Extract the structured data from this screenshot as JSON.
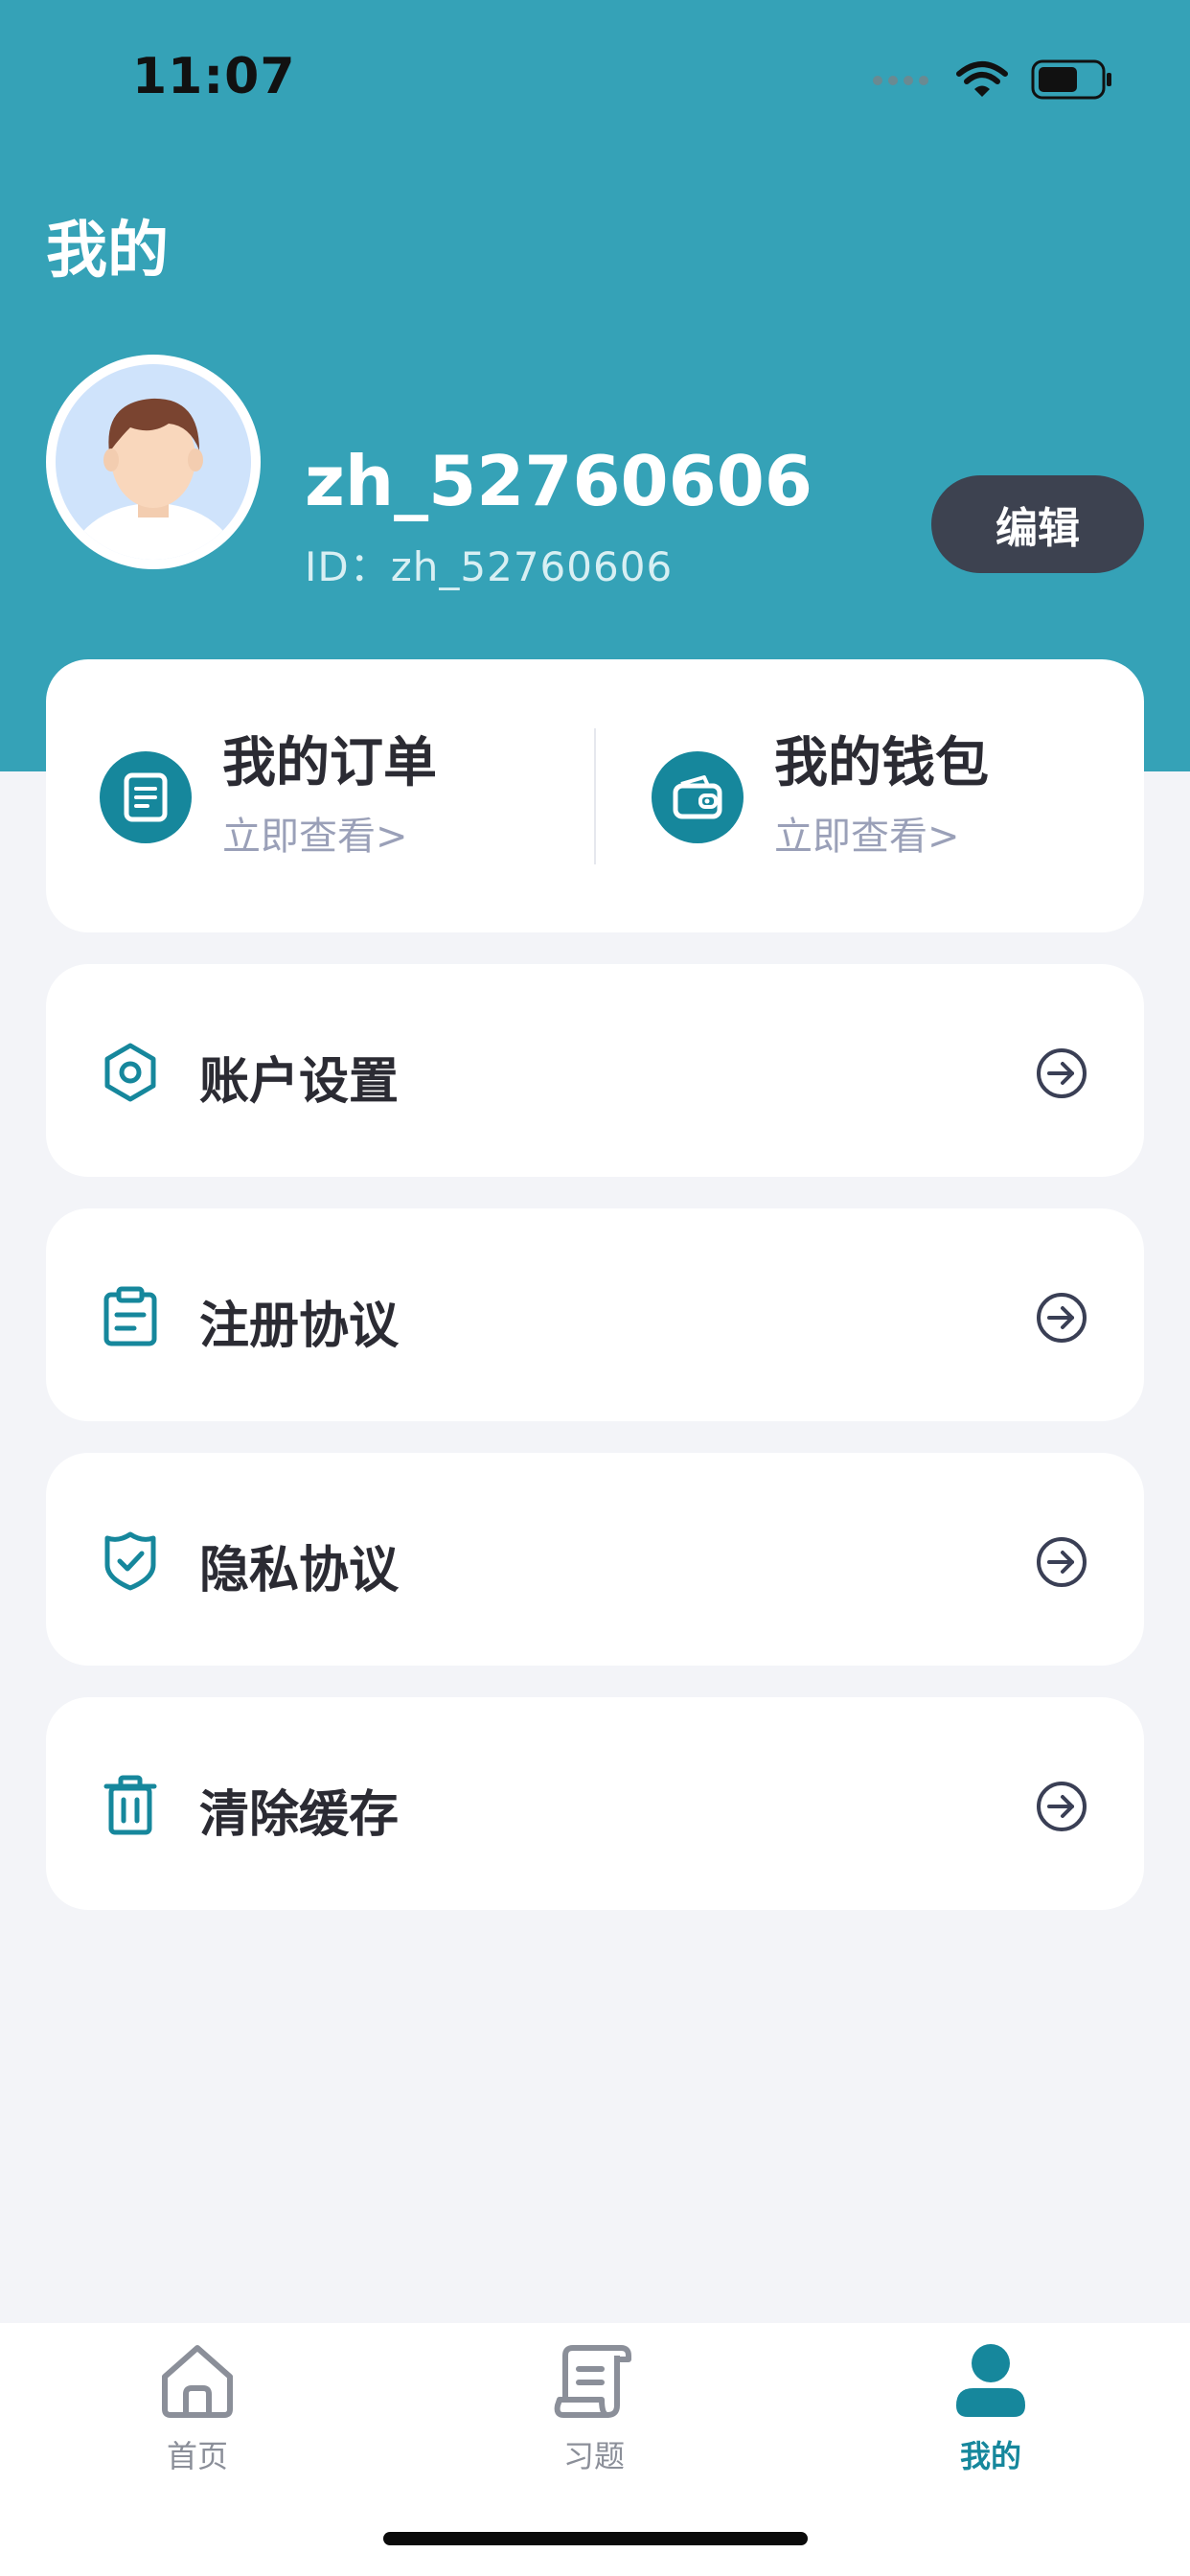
{
  "status_bar": {
    "time": "11:07",
    "icons": [
      "signal-dots-icon",
      "wifi-icon",
      "battery-icon"
    ]
  },
  "header": {
    "title": "我的",
    "background_color": "#35a2b7"
  },
  "profile": {
    "username": "zh_52760606",
    "id_label": "ID：zh_52760606",
    "edit_label": "编辑",
    "avatar_icon": "user-avatar"
  },
  "quick_actions": [
    {
      "title": "我的订单",
      "subtitle": "立即查看>",
      "icon": "order-icon"
    },
    {
      "title": "我的钱包",
      "subtitle": "立即查看>",
      "icon": "wallet-icon"
    }
  ],
  "menu": [
    {
      "label": "账户设置",
      "icon": "hexagon-settings-icon"
    },
    {
      "label": "注册协议",
      "icon": "clipboard-icon"
    },
    {
      "label": "隐私协议",
      "icon": "shield-check-icon"
    },
    {
      "label": "清除缓存",
      "icon": "trash-icon"
    }
  ],
  "tabbar": {
    "items": [
      {
        "label": "首页",
        "icon": "home-icon"
      },
      {
        "label": "习题",
        "icon": "scroll-icon"
      },
      {
        "label": "我的",
        "icon": "user-icon"
      }
    ],
    "active_index": 2
  },
  "colors": {
    "accent": "#16879c",
    "header": "#35a2b7",
    "edit_button": "#3d4250",
    "page_background": "#f3f4f8"
  }
}
